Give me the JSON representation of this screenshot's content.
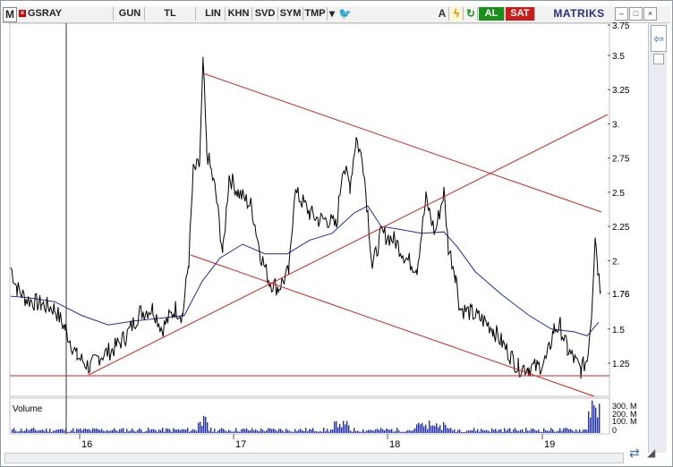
{
  "toolbar": {
    "m_label": "M",
    "symbol": "GSRAY",
    "period": "GUN",
    "currency": "TL",
    "lin": "LIN",
    "khn": "KHN",
    "svd": "SVD",
    "sym": "SYM",
    "tmp": "TMP",
    "buy": "AL",
    "sell": "SAT",
    "logo": "MATRIKS"
  },
  "colors": {
    "price": "#000000",
    "ma": "#1f2fa8",
    "trend": "#d42020",
    "volume": "#1f2fa8",
    "buy": "#1a8f1a",
    "sell": "#cc1b1b"
  },
  "chart_data": {
    "type": "line",
    "y_ticks": [
      "3.75",
      "3.5",
      "3.25",
      "3.",
      "2.75",
      "2.5",
      "2.25",
      "2.",
      "1.76",
      "1.5",
      "1.25"
    ],
    "x_ticks": [
      "16",
      "17",
      "18",
      "19"
    ],
    "last_value_label": "1.76",
    "volume_label": "Volume",
    "volume_ticks": [
      "300. M",
      "200. M",
      "100. M",
      "0"
    ]
  }
}
